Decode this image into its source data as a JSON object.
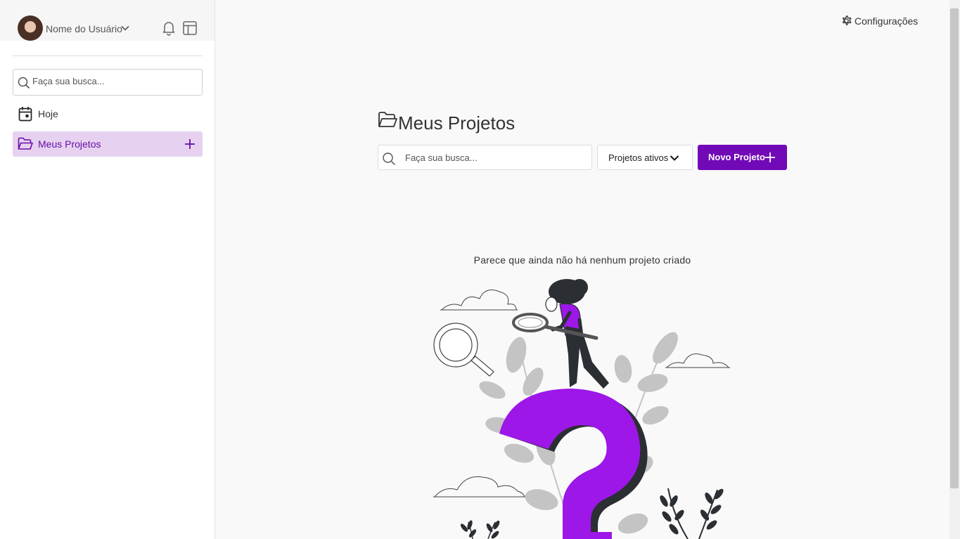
{
  "sidebar": {
    "user_name": "Nome do Usuário",
    "search_placeholder": "Faça sua busca...",
    "items": [
      {
        "label": "Hoje",
        "icon": "calendar-icon"
      },
      {
        "label": "Meus Projetos",
        "icon": "folder-open-icon",
        "active": true
      }
    ]
  },
  "header": {
    "settings_label": "Configurações"
  },
  "main": {
    "title": "Meus Projetos",
    "search_placeholder": "Faça sua busca...",
    "filter_label": "Projetos ativos",
    "new_project_label": "Novo Projeto",
    "empty_message": "Parece que ainda não há nenhum projeto criado"
  },
  "colors": {
    "accent": "#7209b7",
    "accent_light": "#e6d2f0",
    "illustration_purple": "#9d17e8",
    "illustration_dark": "#2b2f33",
    "illustration_gray": "#c4c4c4"
  }
}
